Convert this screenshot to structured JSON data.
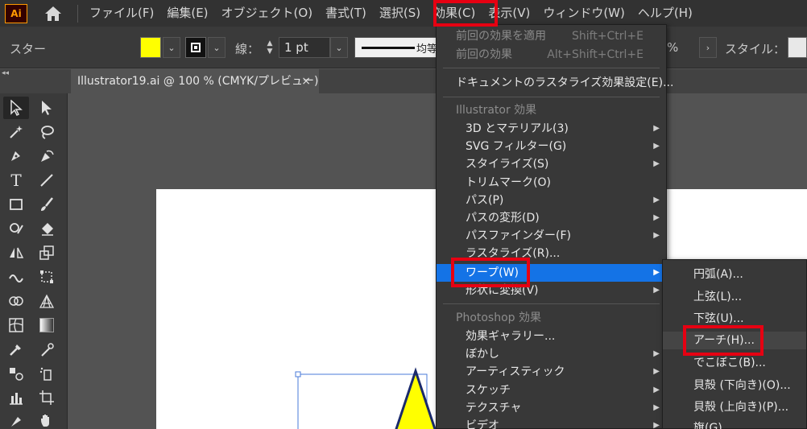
{
  "menubar": {
    "logo": "Ai",
    "items": [
      "ファイル(F)",
      "編集(E)",
      "オブジェクト(O)",
      "書式(T)",
      "選択(S)",
      "効果(C)",
      "表示(V)",
      "ウィンドウ(W)",
      "ヘルプ(H)"
    ]
  },
  "controlbar": {
    "selection_label": "スター",
    "fill_color": "#ffff00",
    "stroke_label": "線：",
    "stroke_weight": "1 pt",
    "stroke_style": "均等",
    "opacity_suffix": "%",
    "style_label": "スタイル："
  },
  "document_tab": {
    "title": "Illustrator19.ai @ 100 % (CMYK/プレビュー)",
    "close": "×"
  },
  "effect_menu": {
    "items": [
      {
        "label": "前回の効果を適用",
        "shortcut": "Shift+Ctrl+E",
        "disabled": true
      },
      {
        "label": "前回の効果",
        "shortcut": "Alt+Shift+Ctrl+E",
        "disabled": true
      },
      {
        "label": "ドキュメントのラスタライズ効果設定(E)..."
      },
      {
        "label": "Illustrator 効果",
        "header": true
      },
      {
        "label": "3D とマテリアル(3)",
        "submenu": true
      },
      {
        "label": "SVG フィルター(G)",
        "submenu": true
      },
      {
        "label": "スタイライズ(S)",
        "submenu": true
      },
      {
        "label": "トリムマーク(O)"
      },
      {
        "label": "パス(P)",
        "submenu": true
      },
      {
        "label": "パスの変形(D)",
        "submenu": true
      },
      {
        "label": "パスファインダー(F)",
        "submenu": true
      },
      {
        "label": "ラスタライズ(R)..."
      },
      {
        "label": "ワープ(W)",
        "submenu": true,
        "highlighted": true
      },
      {
        "label": "形状に変換(V)",
        "submenu": true
      },
      {
        "label": "Photoshop 効果",
        "header": true
      },
      {
        "label": "効果ギャラリー..."
      },
      {
        "label": "ぼかし",
        "submenu": true
      },
      {
        "label": "アーティスティック",
        "submenu": true
      },
      {
        "label": "スケッチ",
        "submenu": true
      },
      {
        "label": "テクスチャ",
        "submenu": true
      },
      {
        "label": "ビデオ",
        "submenu": true
      }
    ]
  },
  "warp_submenu": {
    "items": [
      "円弧(A)...",
      "上弦(L)...",
      "下弦(U)...",
      "アーチ(H)...",
      "でこぼこ(B)...",
      "貝殻 (下向き)(O)...",
      "貝殻 (上向き)(P)...",
      "旗(G)..."
    ],
    "hovered_index": 3
  },
  "colors": {
    "highlight": "#1473e6",
    "annotation": "#e60012",
    "star_fill": "#ffff00",
    "selection": "#4a7bd8"
  }
}
